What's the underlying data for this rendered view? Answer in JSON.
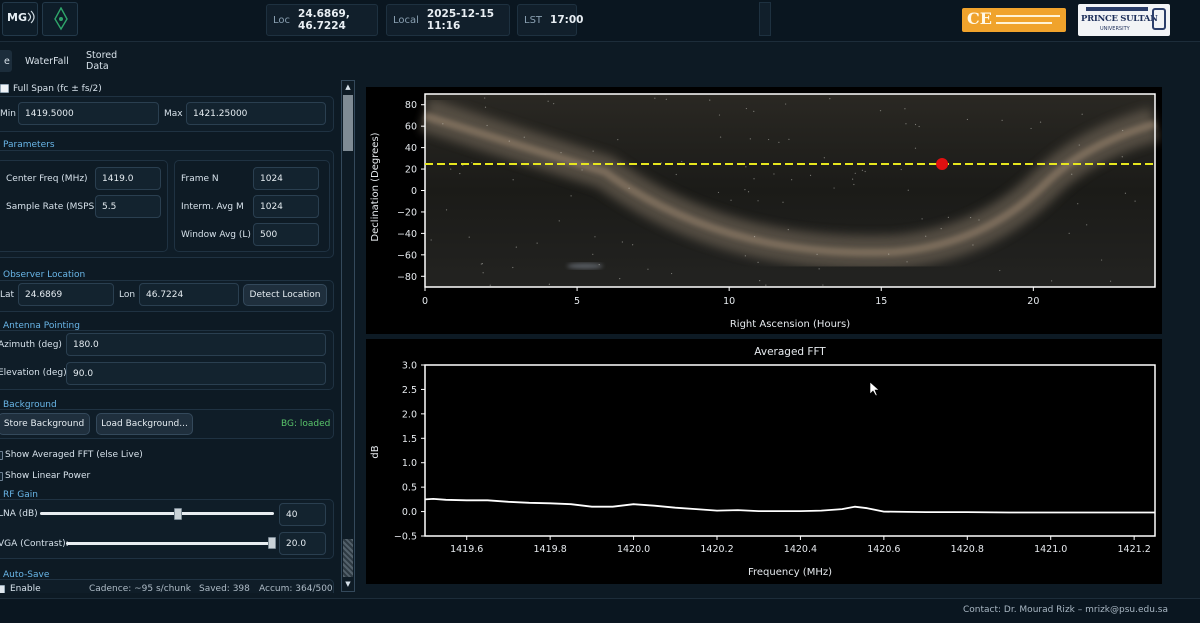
{
  "header": {
    "logo_text": "MG",
    "location_label": "Loc",
    "location_value": "24.6869, 46.7224",
    "local_label": "Local",
    "local_value": "2025-12-15 11:16",
    "lst_label": "LST",
    "lst_value": "17:00",
    "ce_logo_text": "CE",
    "psu_logo_text": "PRINCE SULTAN",
    "psu_logo_sub": "UNIVERSITY"
  },
  "tabs": [
    {
      "label": "e",
      "active": true
    },
    {
      "label": "WaterFall",
      "active": false
    },
    {
      "label": "Stored Data",
      "active": false
    }
  ],
  "span": {
    "full_span_label": "Full Span (fc ± fs/2)",
    "full_span_checked": false,
    "min_label": "Min",
    "min_value": "1419.5000",
    "max_label": "Max",
    "max_value": "1421.25000"
  },
  "parameters": {
    "title": "Parameters",
    "center_freq_label": "Center Freq (MHz)",
    "center_freq_value": "1419.0",
    "sample_rate_label": "Sample Rate (MSPS)",
    "sample_rate_value": "5.5",
    "frame_n_label": "Frame N",
    "frame_n_value": "1024",
    "interm_avg_label": "Interm. Avg M",
    "interm_avg_value": "1024",
    "window_avg_label": "Window Avg (L)",
    "window_avg_value": "500"
  },
  "observer": {
    "title": "Observer Location",
    "lat_label": "Lat",
    "lat_value": "24.6869",
    "lon_label": "Lon",
    "lon_value": "46.7224",
    "detect_button": "Detect Location"
  },
  "antenna": {
    "title": "Antenna Pointing",
    "azimuth_label": "Azimuth (deg)",
    "azimuth_value": "180.0",
    "elevation_label": "Elevation (deg)",
    "elevation_value": "90.0"
  },
  "background": {
    "title": "Background",
    "store_button": "Store Background",
    "load_button": "Load Background...",
    "status": "BG: loaded",
    "status_color": "#59c46a"
  },
  "display": {
    "show_avg_label": "Show Averaged FFT (else Live)",
    "show_linear_label": "Show Linear Power"
  },
  "rf_gain": {
    "title": "RF Gain",
    "lna_label": "LNA (dB)",
    "lna_value": "40",
    "lna_fraction": 0.59,
    "vga_label": "VGA (Contrast):",
    "vga_value": "20.0",
    "vga_fraction": 0.99
  },
  "autosave": {
    "title": "Auto-Save",
    "enable_label": "Enable",
    "enable_checked": true,
    "cadence_text": "Cadence: ~95 s/chunk",
    "saved_text": "Saved: 398",
    "accum_text": "Accum: 364/500"
  },
  "footer": {
    "contact": "Contact: Dr. Mourad Rizk – mrizk@psu.edu.sa"
  },
  "colors": {
    "accent": "#69b6e8",
    "pointing_line": "#e6e61e",
    "pointing_marker": "#e01010"
  },
  "chart_data": [
    {
      "type": "scatter",
      "title": "",
      "xlabel": "Right Ascension (Hours)",
      "ylabel": "Declination (Degrees)",
      "xlim": [
        0,
        24
      ],
      "ylim": [
        -90,
        90
      ],
      "x_ticks": [
        "0",
        "5",
        "10",
        "15",
        "20"
      ],
      "y_ticks": [
        "−80",
        "−60",
        "−40",
        "−20",
        "0",
        "20",
        "40",
        "60",
        "80"
      ],
      "reference_line": {
        "y": 24.7
      },
      "points": [
        {
          "x": 17.0,
          "y": 24.7
        }
      ]
    },
    {
      "type": "line",
      "title": "Averaged FFT",
      "xlabel": "Frequency (MHz)",
      "ylabel": "dB",
      "xlim": [
        1419.5,
        1421.25
      ],
      "ylim": [
        -0.5,
        3.0
      ],
      "x_ticks": [
        "1419.6",
        "1419.8",
        "1420.0",
        "1420.2",
        "1420.4",
        "1420.6",
        "1420.8",
        "1421.0",
        "1421.2"
      ],
      "y_ticks": [
        "−0.5",
        "0.0",
        "0.5",
        "1.0",
        "1.5",
        "2.0",
        "2.5",
        "3.0"
      ],
      "series": [
        {
          "x": [
            1419.5,
            1419.52,
            1419.55,
            1419.6,
            1419.65,
            1419.7,
            1419.75,
            1419.8,
            1419.85,
            1419.9,
            1419.95,
            1420.0,
            1420.05,
            1420.1,
            1420.15,
            1420.2,
            1420.25,
            1420.3,
            1420.35,
            1420.4,
            1420.45,
            1420.5,
            1420.53,
            1420.56,
            1420.6,
            1420.7,
            1420.8,
            1420.9,
            1421.0,
            1421.1,
            1421.25
          ],
          "y": [
            0.25,
            0.26,
            0.24,
            0.23,
            0.23,
            0.2,
            0.18,
            0.17,
            0.15,
            0.1,
            0.1,
            0.15,
            0.12,
            0.08,
            0.05,
            0.02,
            0.03,
            0.01,
            0.01,
            0.01,
            0.02,
            0.05,
            0.1,
            0.07,
            0.0,
            -0.01,
            -0.01,
            -0.02,
            -0.02,
            -0.02,
            -0.02
          ]
        }
      ]
    }
  ]
}
